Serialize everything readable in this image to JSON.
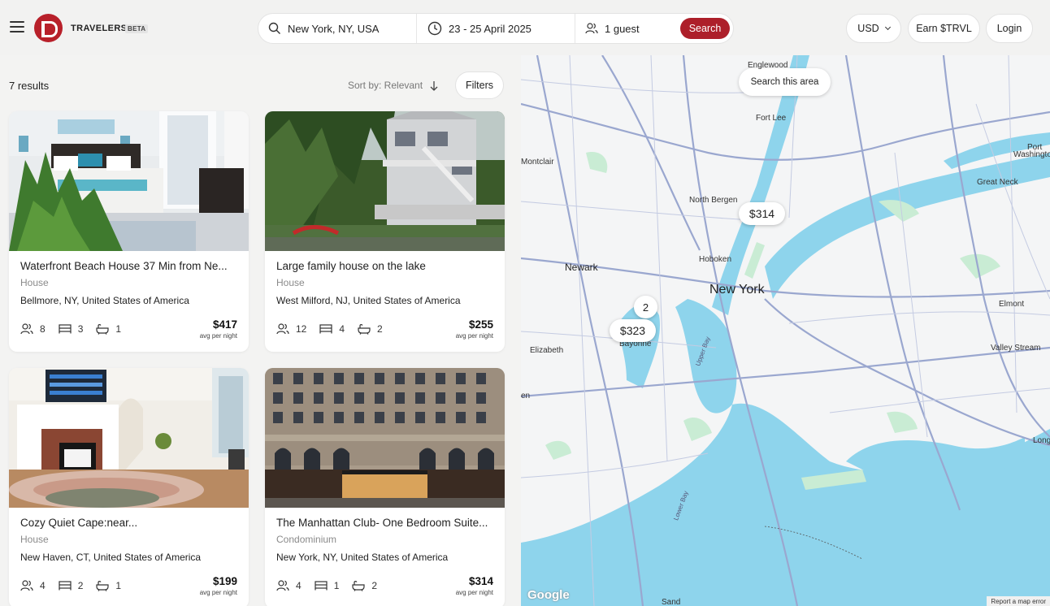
{
  "header": {
    "brand": "TRAVELERS",
    "badge": "BETA",
    "search": {
      "location": "New York, NY, USA",
      "dates": "23 - 25 April 2025",
      "guests": "1 guest",
      "button": "Search"
    },
    "currency": "USD",
    "earn": "Earn $TRVL",
    "login": "Login"
  },
  "results": {
    "count": "7 results",
    "sort": "Sort by: Relevant",
    "filters": "Filters",
    "listings": [
      {
        "title": "Waterfront Beach House 37 Min from Ne...",
        "type": "House",
        "location": "Bellmore, NY, United States of America",
        "guests": "8",
        "bedrooms": "3",
        "baths": "1",
        "price": "$417",
        "per": "avg per night"
      },
      {
        "title": "Large family house on the lake",
        "type": "House",
        "location": "West Milford, NJ, United States of America",
        "guests": "12",
        "bedrooms": "4",
        "baths": "2",
        "price": "$255",
        "per": "avg per night"
      },
      {
        "title": "Cozy Quiet Cape:near...",
        "type": "House",
        "location": "New Haven, CT, United States of America",
        "guests": "4",
        "bedrooms": "2",
        "baths": "1",
        "price": "$199",
        "per": "avg per night"
      },
      {
        "title": "The Manhattan Club- One Bedroom Suite...",
        "type": "Condominium",
        "location": "New York, NY, United States of America",
        "guests": "4",
        "bedrooms": "1",
        "baths": "2",
        "price": "$314",
        "per": "avg per night"
      }
    ]
  },
  "map": {
    "search_area": "Search this area",
    "markers": {
      "m314": "$314",
      "cluster": "2",
      "m323": "$323"
    },
    "labels": {
      "englewood": "Englewood",
      "fortlee": "Fort Lee",
      "montclair": "Montclair",
      "northbergen": "North Bergen",
      "newark": "Newark",
      "hoboken": "Hoboken",
      "newyork": "New York",
      "bayonne": "Bayonne",
      "elizabeth": "Elizabeth",
      "upperbay": "Upper Bay",
      "lowerbay": "Lower Bay",
      "portwashington1": "Port",
      "portwashington2": "Washington",
      "greatneck": "Great Neck",
      "elmont": "Elmont",
      "valleystream": "Valley Stream",
      "long": "Long",
      "en": "en",
      "sand": "Sand"
    },
    "google": "Google",
    "report": "Report a map error"
  },
  "colors": {
    "brand": "#b8202a",
    "search_button": "#ad1f2a",
    "water": "#8ed4ec",
    "park": "#c9ecd4",
    "road": "#9aa7cf"
  }
}
